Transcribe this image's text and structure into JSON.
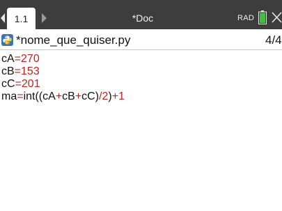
{
  "header": {
    "tab_label": "1.1",
    "doc_title": "*Doc",
    "mode": "RAD"
  },
  "file": {
    "name": "*nome_que_quiser.py",
    "page": "4/4"
  },
  "code": {
    "line1": {
      "var": "cA",
      "eq": "=",
      "num": "270"
    },
    "line2": {
      "var": "cB",
      "eq": "=",
      "num": "153"
    },
    "line3": {
      "var": "cC",
      "eq": "=",
      "num": "201"
    },
    "line4": {
      "var": "ma",
      "eq": "=",
      "fn": "int((cA",
      "plus1": "+",
      "b": "cB",
      "plus2": "+",
      "c": "cC)",
      "div": "/",
      "two": "2",
      "close": ")",
      "plus3": "+",
      "one": "1"
    }
  },
  "colors": {
    "topbar": "#3d3d3d",
    "accent_red": "#c81e1e",
    "battery_green": "#3fbf3f",
    "python_blue": "#3b73b9"
  },
  "icons": [
    "chevron-left-icon",
    "chevron-right-icon",
    "battery-icon",
    "close-icon",
    "python-file-icon"
  ]
}
